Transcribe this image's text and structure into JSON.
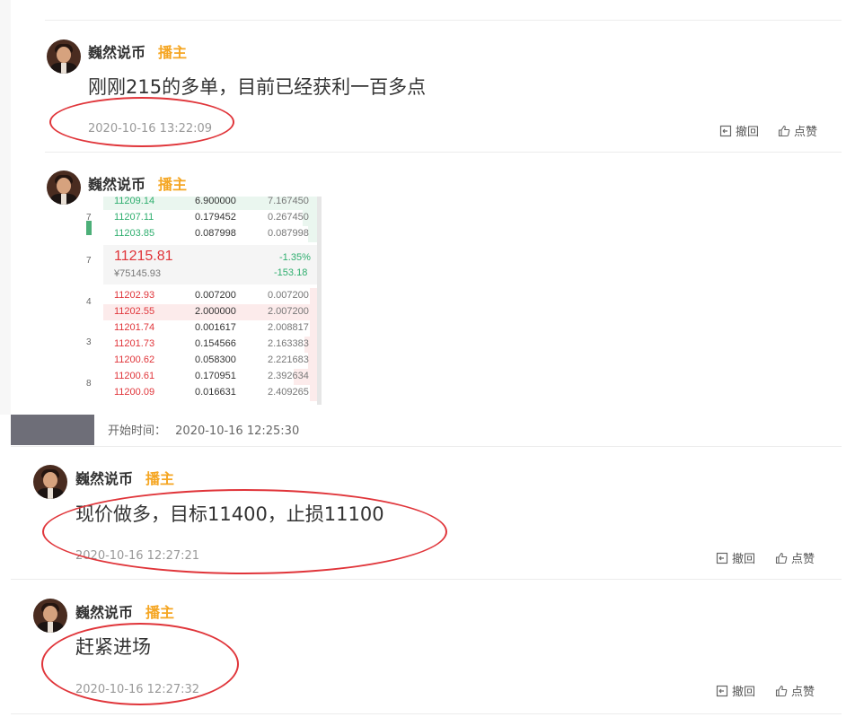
{
  "messages": [
    {
      "user": "巍然说币",
      "role": "播主",
      "text": "刚刚215的多单，目前已经获利一百多点",
      "time": "2020-10-16 13:22:09",
      "withdraw": "撤回",
      "like": "点赞"
    },
    {
      "user": "巍然说币",
      "role": "播主"
    },
    {
      "user": "巍然说币",
      "role": "播主",
      "text": "现价做多，目标11400，止损11100",
      "time": "2020-10-16 12:27:21",
      "withdraw": "撤回",
      "like": "点赞"
    },
    {
      "user": "巍然说币",
      "role": "播主",
      "text": "赶紧进场",
      "time": "2020-10-16 12:27:32",
      "withdraw": "撤回",
      "like": "点赞"
    }
  ],
  "start_time": {
    "label": "开始时间：",
    "value": "2020-10-16 12:25:30"
  },
  "orderbook": {
    "asks": [
      {
        "price": "11209.14",
        "amount": "6.900000",
        "total": "7.167450"
      },
      {
        "price": "11207.11",
        "amount": "0.179452",
        "total": "0.267450"
      },
      {
        "price": "11203.85",
        "amount": "0.087998",
        "total": "0.087998"
      }
    ],
    "last_price": "11215.81",
    "cny": "¥75145.93",
    "change_pct": "-1.35%",
    "change_abs": "-153.18",
    "bids": [
      {
        "price": "11202.93",
        "amount": "0.007200",
        "total": "0.007200"
      },
      {
        "price": "11202.55",
        "amount": "2.000000",
        "total": "2.007200"
      },
      {
        "price": "11201.74",
        "amount": "0.001617",
        "total": "2.008817"
      },
      {
        "price": "11201.73",
        "amount": "0.154566",
        "total": "2.163383"
      },
      {
        "price": "11200.62",
        "amount": "0.058300",
        "total": "2.221683"
      },
      {
        "price": "11200.61",
        "amount": "0.170951",
        "total": "2.392634"
      },
      {
        "price": "11200.09",
        "amount": "0.016631",
        "total": "2.409265"
      }
    ],
    "gutter_labels": [
      "7",
      "7",
      "4",
      "3",
      "8"
    ]
  },
  "colors": {
    "accent_badge": "#f5a623",
    "annotation": "#e0353a",
    "ask": "#2eae6e",
    "bid": "#e0353a"
  }
}
